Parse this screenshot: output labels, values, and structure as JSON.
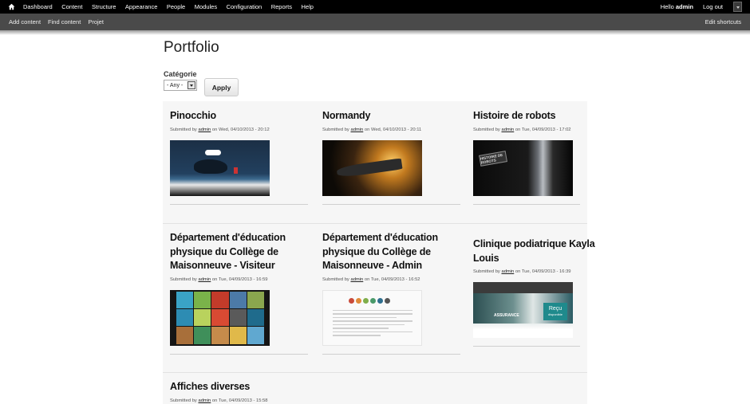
{
  "toolbar": {
    "menu": [
      "Dashboard",
      "Content",
      "Structure",
      "Appearance",
      "People",
      "Modules",
      "Configuration",
      "Reports",
      "Help"
    ],
    "hello_prefix": "Hello ",
    "username": "admin",
    "logout": "Log out"
  },
  "shortcuts": {
    "links": [
      "Add content",
      "Find content",
      "Projet"
    ],
    "edit": "Edit shortcuts"
  },
  "page": {
    "title": "Portfolio",
    "filter_label": "Catégorie",
    "select_value": "- Any -",
    "apply_label": "Apply"
  },
  "submitted_by": "Submitted by",
  "on_word": "on",
  "items": [
    {
      "title": "Pinocchio",
      "author": "admin",
      "date": "Wed, 04/10/2013 - 20:12"
    },
    {
      "title": "Normandy",
      "author": "admin",
      "date": "Wed, 04/10/2013 - 20:11"
    },
    {
      "title": "Histoire de robots",
      "author": "admin",
      "date": "Tue, 04/09/2013 - 17:02",
      "thumb_text": "HISTOIRE DE ROBOTS"
    },
    {
      "title": "Département d'éducation physique du Collège de Maisonneuve - Visiteur",
      "author": "admin",
      "date": "Tue, 04/09/2013 - 16:59"
    },
    {
      "title": "Département d'éducation physique du Collège de Maisonneuve - Admin",
      "author": "admin",
      "date": "Tue, 04/09/2013 - 16:52"
    },
    {
      "title": "Clinique podiatrique Kayla Louis",
      "author": "admin",
      "date": "Tue, 04/09/2013 - 16:39",
      "thumb_badge": "Reçu",
      "thumb_badge_sub": "disponible",
      "thumb_label": "ASSURANCE"
    },
    {
      "title": "Affiches diverses",
      "author": "admin",
      "date": "Tue, 04/09/2013 - 15:58"
    }
  ]
}
